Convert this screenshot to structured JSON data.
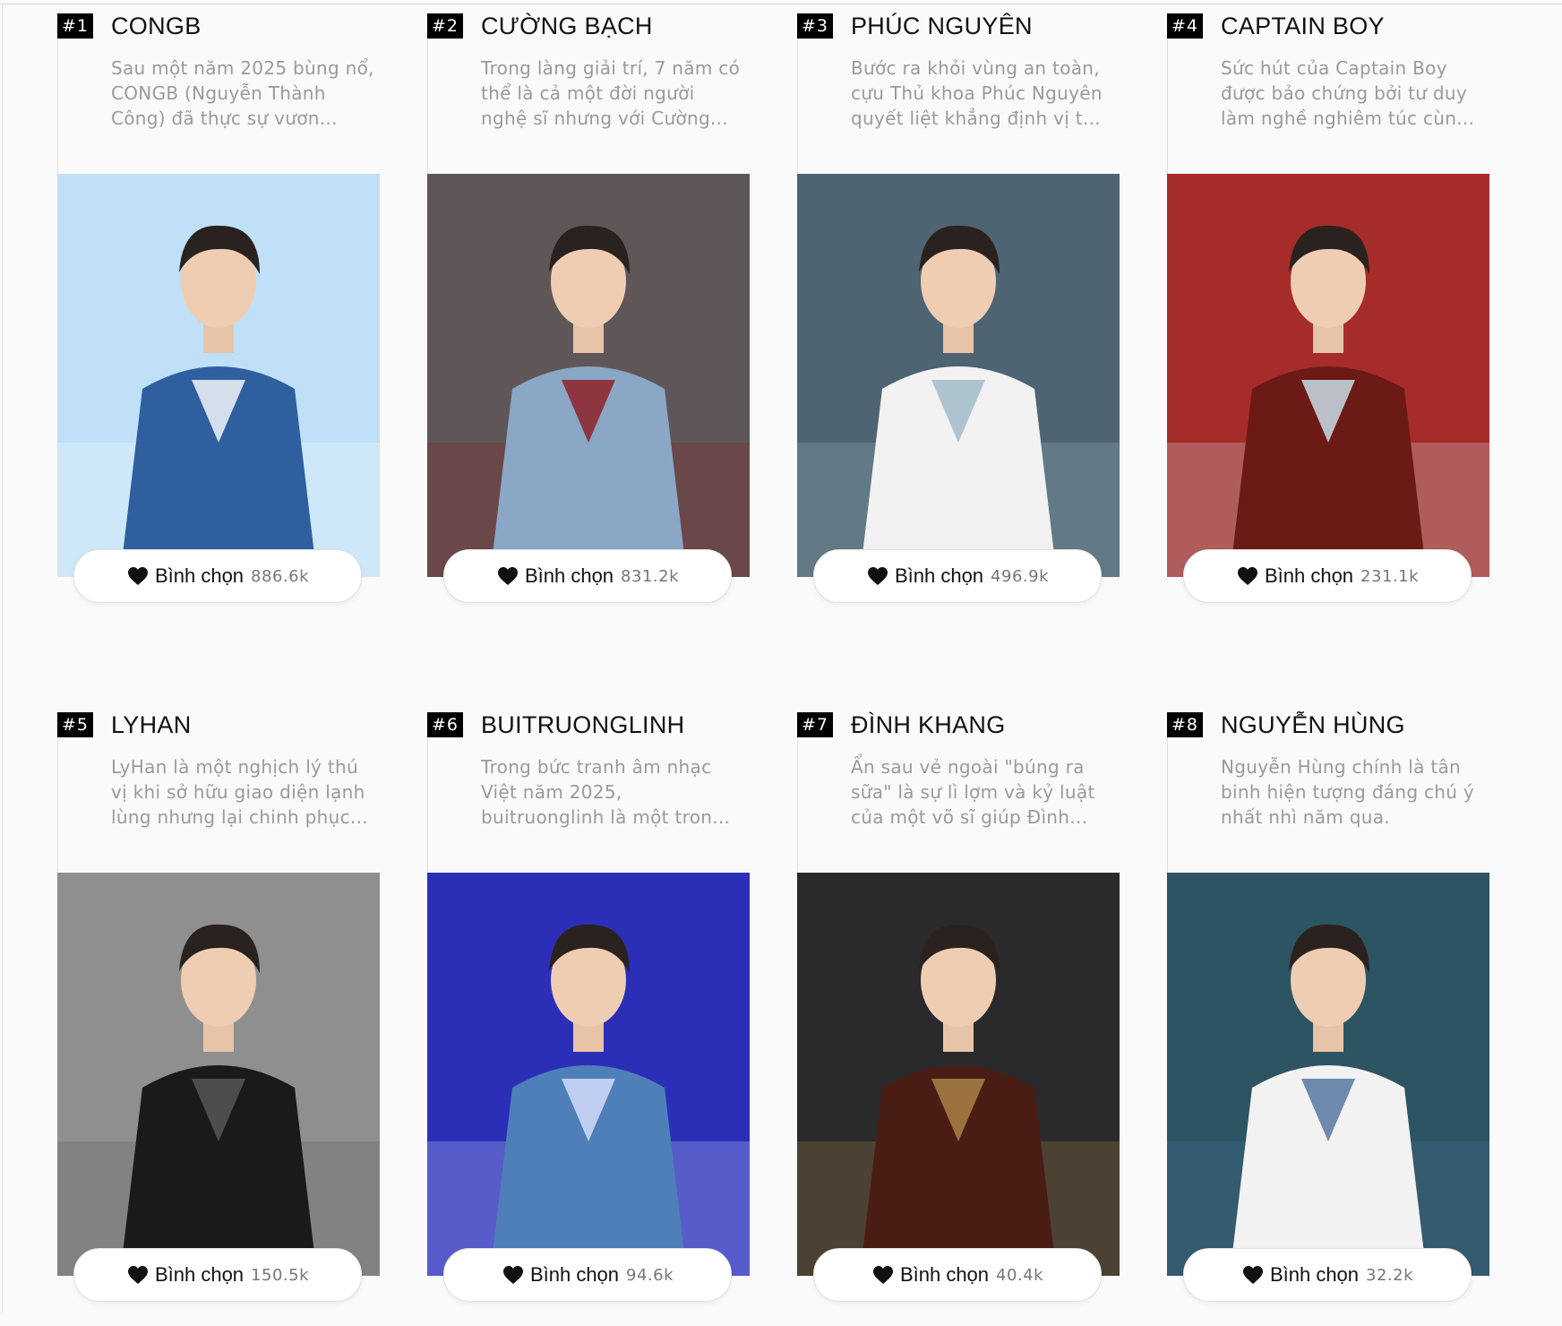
{
  "vote_label": "Bình chọn",
  "artists": [
    {
      "rank": "#1",
      "name": "CONGB",
      "desc": "Sau một năm 2025 bùng nổ, CONGB (Nguyễn Thành Công) đã thực sự vươn...",
      "votes": "886.6k",
      "photo_bg": "#bfe0f7",
      "photo_main": "#2f5f9e",
      "photo_accent": "#ffffff"
    },
    {
      "rank": "#2",
      "name": "CƯỜNG BẠCH",
      "desc": "Trong làng giải trí, 7 năm có thể là cả một đời người nghệ sĩ nhưng với Cường...",
      "votes": "831.2k",
      "photo_bg": "#5e5657",
      "photo_main": "#8aa7c6",
      "photo_accent": "#8e1a1d"
    },
    {
      "rank": "#3",
      "name": "PHÚC NGUYÊN",
      "desc": "Bước ra khỏi vùng an toàn, cựu Thủ khoa Phúc Nguyên quyết liệt khẳng định vị t...",
      "votes": "496.9k",
      "photo_bg": "#4f6472",
      "photo_main": "#f2f2f2",
      "photo_accent": "#9bb6c4"
    },
    {
      "rank": "#4",
      "name": "CAPTAIN BOY",
      "desc": "Sức hút của Captain Boy được bảo chứng bởi tư duy làm nghề nghiêm túc cùn...",
      "votes": "231.1k",
      "photo_bg": "#a62c2a",
      "photo_main": "#6b1a15",
      "photo_accent": "#cfe9f5"
    },
    {
      "rank": "#5",
      "name": "LYHAN",
      "desc": "LyHan là một nghịch lý thú vị khi sở hữu giao diện lạnh lùng nhưng lại chinh phục...",
      "votes": "150.5k",
      "photo_bg": "#8f8f8f",
      "photo_main": "#1a1a1a",
      "photo_accent": "#5a5a5a"
    },
    {
      "rank": "#6",
      "name": "BUITRUONGLINH",
      "desc": "Trong bức tranh âm nhạc Việt năm 2025, buitruonglinh là một tron...",
      "votes": "94.6k",
      "photo_bg": "#2b2fb8",
      "photo_main": "#4f7fb8",
      "photo_accent": "#dbe2ff"
    },
    {
      "rank": "#7",
      "name": "ĐÌNH KHANG",
      "desc": "Ẩn sau vẻ ngoài \"búng ra sữa\" là sự lì lợm và kỷ luật của một võ sĩ giúp Đình...",
      "votes": "40.4k",
      "photo_bg": "#2a2a2c",
      "photo_main": "#4a1d14",
      "photo_accent": "#b08a4a"
    },
    {
      "rank": "#8",
      "name": "NGUYỄN HÙNG",
      "desc": "Nguyễn Hùng chính là tân binh hiện tượng đáng chú ý nhất nhì năm qua.",
      "votes": "32.2k",
      "photo_bg": "#2d5462",
      "photo_main": "#f2f2f2",
      "photo_accent": "#4c6f9a"
    }
  ]
}
